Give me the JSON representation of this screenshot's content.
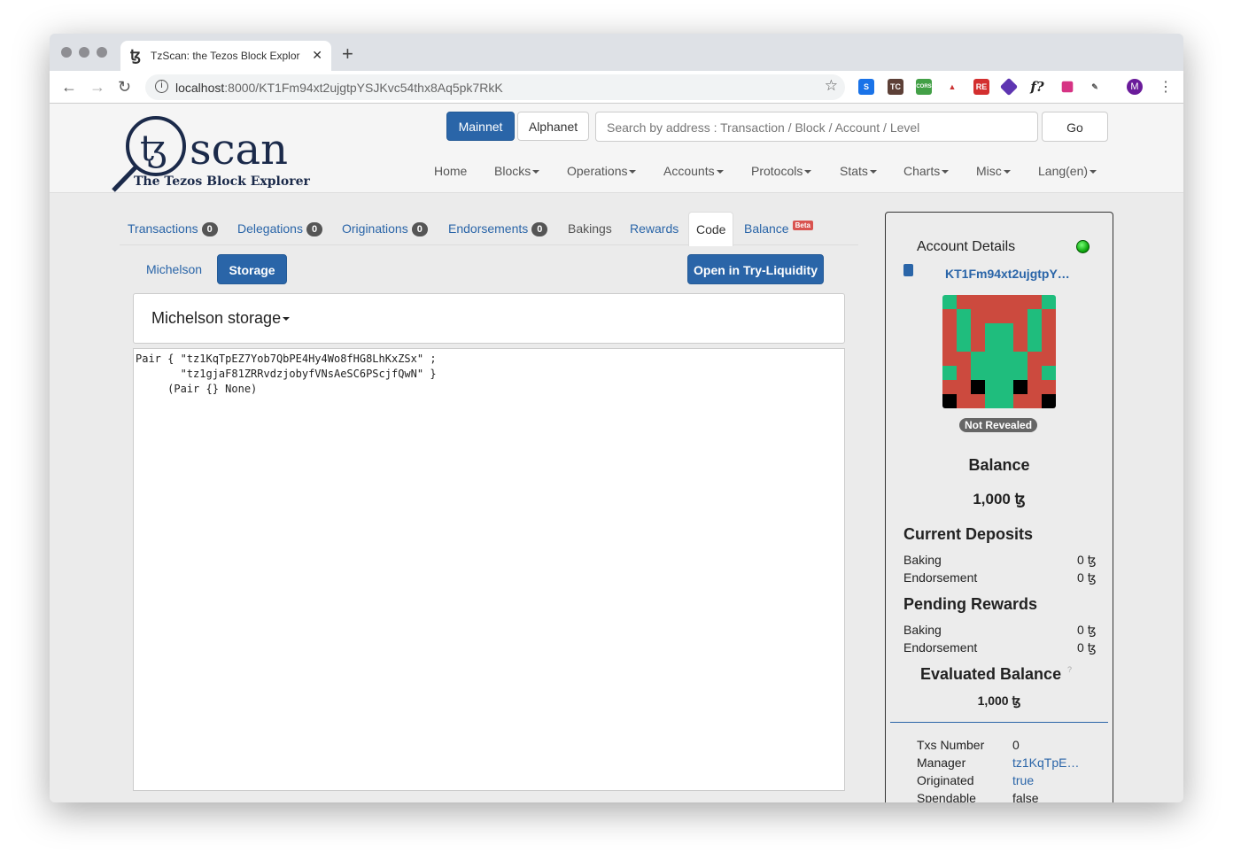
{
  "browser": {
    "tab_title": "TzScan: the Tezos Block Explor",
    "url_host": "localhost",
    "url_path": ":8000/KT1Fm94xt2ujgtpYSJKvc54thx8Aq5pk7RkK",
    "profile_initial": "M"
  },
  "header": {
    "logo_text": "scan",
    "logo_tagline": "The Tezos Block Explorer",
    "networks": [
      "Mainnet",
      "Alphanet"
    ],
    "search_placeholder": "Search by address : Transaction / Block / Account / Level",
    "go_label": "Go",
    "menu": [
      "Home",
      "Blocks",
      "Operations",
      "Accounts",
      "Protocols",
      "Stats",
      "Charts",
      "Misc",
      "Lang(en)"
    ]
  },
  "tabs": [
    {
      "label": "Transactions",
      "count": "0"
    },
    {
      "label": "Delegations",
      "count": "0"
    },
    {
      "label": "Originations",
      "count": "0"
    },
    {
      "label": "Endorsements",
      "count": "0"
    },
    {
      "label": "Bakings"
    },
    {
      "label": "Rewards"
    },
    {
      "label": "Code"
    },
    {
      "label": "Balance",
      "badge": "Beta"
    }
  ],
  "code": {
    "subtabs": [
      "Michelson",
      "Storage"
    ],
    "active_subtab": "Storage",
    "open_button": "Open in Try-Liquidity",
    "panel_title": "Michelson storage",
    "storage": "Pair { \"tz1KqTpEZ7Yob7QbPE4Hy4Wo8fHG8LhKxZSx\" ;\n       \"tz1gjaF81ZRRvdzjobyfVNsAeSC6PScjfQwN\" }\n     (Pair {} None)"
  },
  "account": {
    "title": "Account Details",
    "address": "KT1Fm94xt2ujgtpY…",
    "status_badge": "Not Revealed",
    "identicon": [
      "GRRRRRRG",
      "RGRRRRGR",
      "RGRGGRGR",
      "RGRGGRGR",
      "RRGGGGRR",
      "GRGGGGRG",
      "RRKGGKRR",
      "KRRGGRRK"
    ],
    "balance_title": "Balance",
    "balance": "1,000 ꜩ",
    "deposits_title": "Current Deposits",
    "deposits": [
      {
        "label": "Baking",
        "value": "0 ꜩ"
      },
      {
        "label": "Endorsement",
        "value": "0 ꜩ"
      }
    ],
    "rewards_title": "Pending Rewards",
    "rewards": [
      {
        "label": "Baking",
        "value": "0 ꜩ"
      },
      {
        "label": "Endorsement",
        "value": "0 ꜩ"
      }
    ],
    "evaluated_title": "Evaluated Balance",
    "evaluated_help": "?",
    "evaluated": "1,000 ꜩ",
    "details": [
      {
        "label": "Txs Number",
        "value": "0"
      },
      {
        "label": "Manager",
        "value": "tz1KqTpE…"
      },
      {
        "label": "Originated",
        "value": "true"
      },
      {
        "label": "Spendable",
        "value": "false"
      }
    ]
  },
  "colors": {
    "primary": "#2a65a8",
    "green": "#1fbd7d",
    "red": "#cc4a3e"
  }
}
